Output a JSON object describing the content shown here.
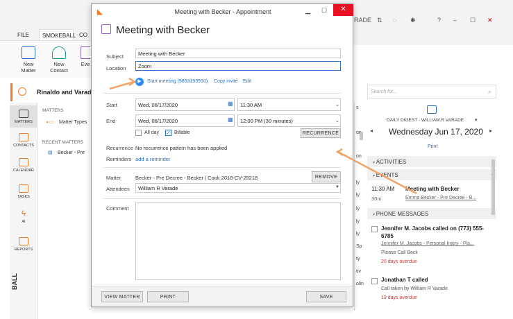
{
  "bg": {
    "tabs": [
      "FILE",
      "SMOKEBALL",
      "CO"
    ],
    "ribbon": [
      {
        "label": "New\nMatter"
      },
      {
        "label": "New\nContact"
      },
      {
        "label": "Eve"
      }
    ],
    "titlebar_trailing": "RADE",
    "banner_name": "Rinaldo and Varade",
    "search_placeholder": "Search for...",
    "nav": [
      "MATTERS",
      "CONTACTS",
      "CALENDAR",
      "TASKS",
      "AI",
      "REPORTS"
    ],
    "side": {
      "matters": "MATTERS",
      "matter_types": "Matter Types",
      "recent": "RECENT MATTERS",
      "recent_item": "Becker - Pre"
    },
    "vertical_label": "BALL",
    "right_fragments": [
      "s",
      "on",
      "on",
      "ly",
      "ly",
      "ly",
      "ly",
      "ly",
      "Sp",
      "ty",
      "tiv",
      "olin"
    ],
    "colors": {
      "accent": "#f07c2a",
      "link": "#2a72c9",
      "overdue": "#d0312d"
    }
  },
  "digest": {
    "header": "DAILY DIGEST - WILLIAM R VARADE",
    "date": "Wednesday Jun 17, 2020",
    "print": "Print",
    "activities": "ACTIVITIES",
    "events": "EVENTS",
    "event": {
      "time": "11:30 AM",
      "duration": "30m",
      "title": "Meeting with Becker",
      "sub": "Emma Becker - Pre Decree - B..."
    },
    "phone_messages": "PHONE MESSAGES",
    "messages": [
      {
        "title": "Jennifer M. Jacobs called on (773) 555-6785",
        "link": "Jennifer M. Jacobs - Personal Injury - Pla...",
        "note": "Please Call Back",
        "overdue": "20 days overdue"
      },
      {
        "title": "Jonathan T called",
        "link": "",
        "note": "Call taken by William R Varade",
        "overdue": "19 days overdue"
      }
    ]
  },
  "dialog": {
    "window_title": "Meeting with Becker - Appointment",
    "heading": "Meeting with Becker",
    "subject_label": "Subject",
    "subject_value": "Meeting with Becker",
    "location_label": "Location",
    "location_value": "Zoom",
    "zoom_start": "Start meeting (9853193910)",
    "zoom_copy": "Copy invite",
    "zoom_edit": "Edit",
    "start_label": "Start",
    "start_date": "Wed, 06/17/2020",
    "start_time": "11:30 AM",
    "end_label": "End",
    "end_date": "Wed, 06/17/2020",
    "end_time": "12:00 PM (30 minutes)",
    "all_day": "All day",
    "billable": "Billable",
    "recurrence_btn": "RECURRENCE",
    "recurrence_label": "Recurrence",
    "recurrence_value": "No recurrence pattern has been applied",
    "reminders_label": "Reminders",
    "add_reminder": "add a reminder",
    "matter_label": "Matter",
    "matter_value": "Becker - Pre Decree - Becker | Cook 2018-CV-29218",
    "remove_btn": "REMOVE",
    "attendees_label": "Attendees",
    "attendees_value": "William R Varade",
    "comment_label": "Comment",
    "view_matter_btn": "VIEW MATTER",
    "print_btn": "PRINT",
    "save_btn": "SAVE"
  }
}
